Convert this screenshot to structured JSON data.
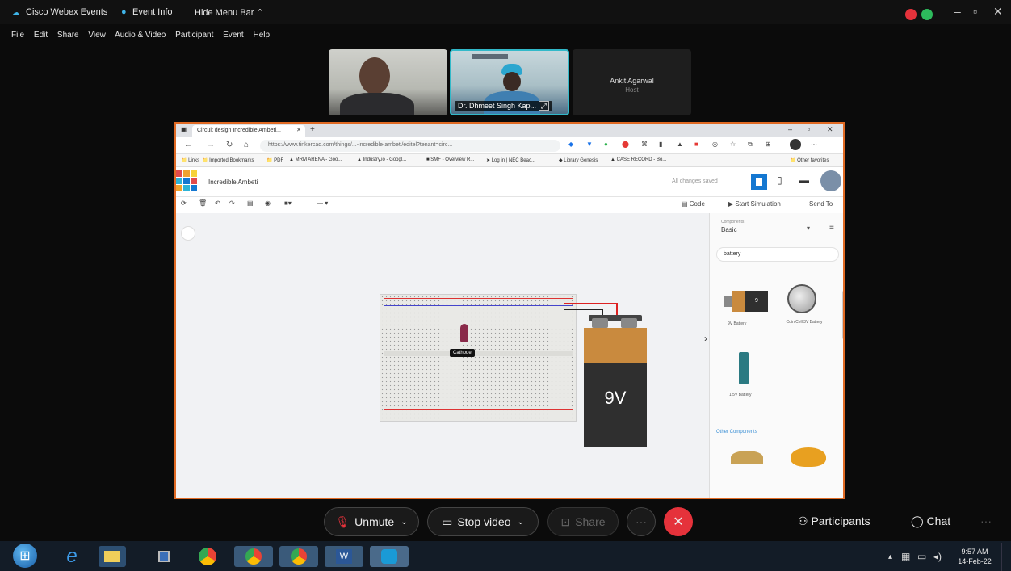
{
  "webex": {
    "app_title": "Cisco Webex Events",
    "event_info": "Event Info",
    "hide_menu": "Hide Menu Bar ⌃",
    "menu": [
      "File",
      "Edit",
      "Share",
      "View",
      "Audio & Video",
      "Participant",
      "Event",
      "Help"
    ]
  },
  "tiles": {
    "presenter_label": "Dr. Dhmeet Singh Kap...",
    "user3_name": "Ankit Agarwal",
    "user3_role": "Host"
  },
  "browser": {
    "tab_title": "Circuit design Incredible Ambeti...",
    "url": "https://www.tinkercad.com/things/...-incredible-ambeti/editel?tenant=circ...",
    "bookmarks": [
      "Links",
      "Imported Bookmarks",
      "PDF",
      "MRM ARENA - Goo...",
      "Industry.io - Googl...",
      "SMF - Overview R...",
      "Log in | NEC Beac...",
      "Library Genesis",
      "CASE RECORD - Bo...",
      "Other favorites"
    ]
  },
  "tinkercad": {
    "project_title": "Incredible Ambeti",
    "saved_status": "All changes saved",
    "code_label": "Code",
    "start_sim_label": "Start Simulation",
    "send_to_label": "Send To",
    "components_caption": "Components",
    "components_select": "Basic",
    "search_value": "battery",
    "comp1_label": "9V Battery",
    "comp2_label": "Coin Cell 3V Battery",
    "comp3_label": "1.5V Battery",
    "other_components": "Other Components",
    "tooltip": "Cathode",
    "battery_text": "9V"
  },
  "controls": {
    "unmute": "Unmute",
    "stop_video": "Stop video",
    "share": "Share",
    "participants": "Participants",
    "chat": "Chat"
  },
  "tray": {
    "time": "9:57 AM",
    "date": "14-Feb-22"
  },
  "colors": {
    "accent_orange": "#e06a24",
    "end_red": "#e5323b",
    "webex_cyan": "#32b9c9",
    "tinkercad_blue": "#1477d1"
  }
}
